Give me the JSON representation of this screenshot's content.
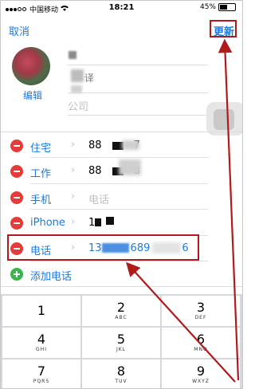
{
  "status_bar": {
    "carrier": "中国移动",
    "time": "18:21",
    "battery": "45%",
    "battery_level": 0.45
  },
  "nav": {
    "cancel": "取消",
    "update": "更新"
  },
  "contact": {
    "edit": "编辑",
    "name_fragment": "译",
    "company_placeholder": "公司"
  },
  "phones": [
    {
      "label": "住宅",
      "value_start": "88",
      "value_end": "7"
    },
    {
      "label": "工作",
      "value_start": "88",
      "value_end": "8"
    },
    {
      "label": "手机",
      "placeholder": "电话"
    },
    {
      "label": "iPhone",
      "value_start": "1"
    },
    {
      "label": "电话",
      "value_a": "13",
      "value_b": "689",
      "value_c": "6"
    }
  ],
  "add_phone": "添加电话",
  "keypad": [
    {
      "num": "1",
      "letters": ""
    },
    {
      "num": "2",
      "letters": "ABC"
    },
    {
      "num": "3",
      "letters": "DEF"
    },
    {
      "num": "4",
      "letters": "GHI"
    },
    {
      "num": "5",
      "letters": "JKL"
    },
    {
      "num": "6",
      "letters": "MNO"
    },
    {
      "num": "7",
      "letters": "PQRS"
    },
    {
      "num": "8",
      "letters": "TUV"
    },
    {
      "num": "9",
      "letters": "WXYZ"
    }
  ],
  "annotation_color": "#b11a1a",
  "accent": "#1a7ae0"
}
